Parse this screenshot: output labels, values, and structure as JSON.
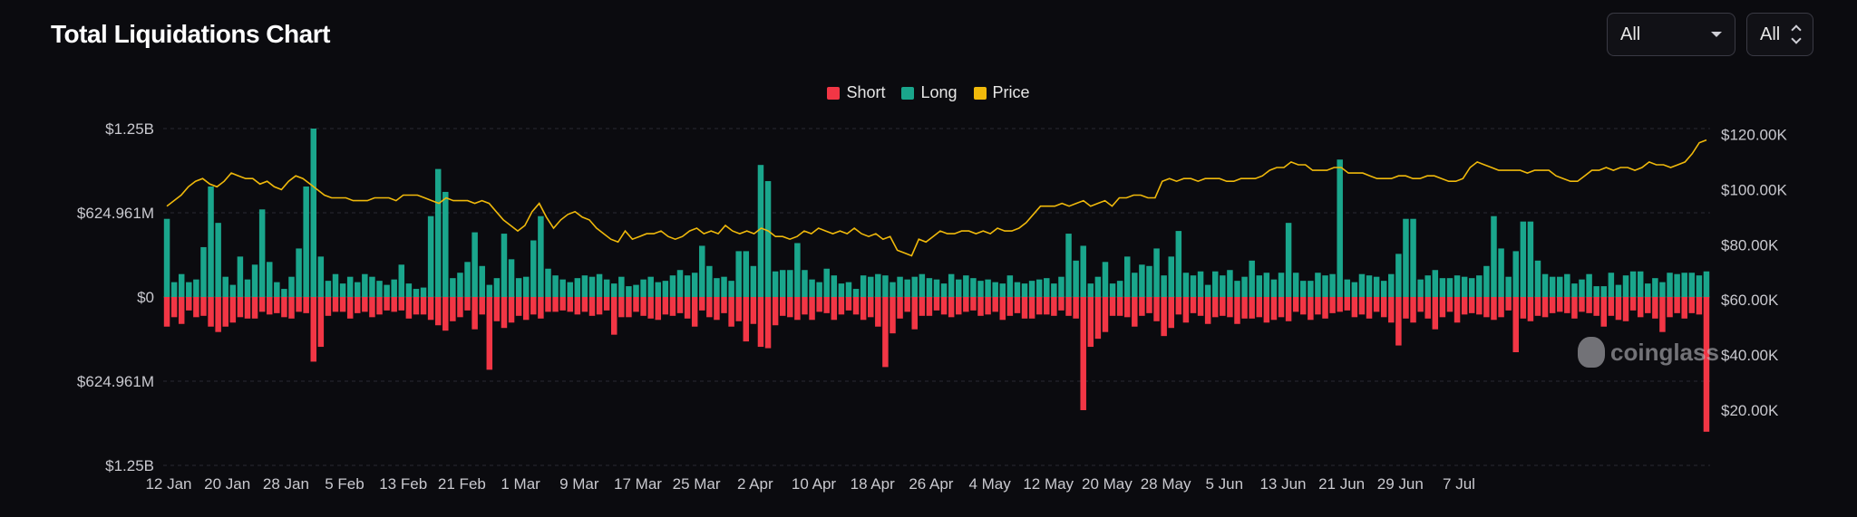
{
  "header": {
    "title": "Total Liquidations Chart"
  },
  "controls": {
    "exchange_select": "All",
    "coin_select": "All"
  },
  "watermark": "coinglass",
  "colors": {
    "short": "#f23645",
    "long": "#1aa68c",
    "price": "#f0b90b",
    "background": "#0b0b0f",
    "grid": "#2a2a33",
    "text": "#c9c9cf"
  },
  "chart_data": {
    "type": "bar",
    "title": "Total Liquidations Chart",
    "legend": [
      {
        "name": "Short",
        "color": "#f23645"
      },
      {
        "name": "Long",
        "color": "#1aa68c"
      },
      {
        "name": "Price",
        "color": "#f0b90b"
      }
    ],
    "legend_position": "top-center",
    "left_axis": {
      "ticks": [
        "$1.25B",
        "$624.961M",
        "$0",
        "$624.961M",
        "$1.25B"
      ],
      "range_millions": [
        -1250,
        1250
      ]
    },
    "right_axis": {
      "ticks": [
        "$120.00K",
        "$100.00K",
        "$80.00K",
        "$60.00K",
        "$40.00K",
        "$20.00K"
      ],
      "range": [
        0,
        130000
      ]
    },
    "x_ticks": [
      "12 Jan",
      "20 Jan",
      "28 Jan",
      "5 Feb",
      "13 Feb",
      "21 Feb",
      "1 Mar",
      "9 Mar",
      "17 Mar",
      "25 Mar",
      "2 Apr",
      "10 Apr",
      "18 Apr",
      "26 Apr",
      "4 May",
      "12 May",
      "20 May",
      "28 May",
      "5 Jun",
      "13 Jun",
      "21 Jun",
      "29 Jun",
      "7 Jul"
    ],
    "start_date": "12 Jan",
    "long_millions": [
      580,
      110,
      170,
      110,
      130,
      370,
      820,
      550,
      150,
      90,
      300,
      130,
      240,
      650,
      260,
      110,
      60,
      150,
      360,
      820,
      1250,
      300,
      120,
      170,
      100,
      150,
      110,
      170,
      150,
      120,
      90,
      130,
      240,
      100,
      60,
      70,
      600,
      950,
      780,
      140,
      180,
      260,
      480,
      230,
      90,
      140,
      470,
      280,
      140,
      150,
      420,
      600,
      210,
      160,
      130,
      110,
      140,
      160,
      150,
      170,
      130,
      100,
      150,
      80,
      90,
      130,
      150,
      110,
      120,
      160,
      200,
      160,
      180,
      380,
      230,
      140,
      150,
      120,
      340,
      340,
      230,
      980,
      860,
      190,
      200,
      200,
      400,
      200,
      130,
      110,
      210,
      160,
      100,
      110,
      60,
      160,
      150,
      170,
      160,
      110,
      150,
      130,
      150,
      170,
      140,
      130,
      100,
      170,
      130,
      160,
      140,
      120,
      130,
      110,
      100,
      160,
      110,
      100,
      120,
      130,
      140,
      100,
      150,
      470,
      270,
      380,
      100,
      150,
      260,
      100,
      120,
      300,
      180,
      240,
      230,
      360,
      160,
      300,
      490,
      180,
      160,
      190,
      90,
      190,
      160,
      200,
      120,
      150,
      270,
      160,
      180,
      130,
      180,
      550,
      180,
      120,
      120,
      180,
      160,
      170,
      1020,
      130,
      110,
      170,
      160,
      150,
      120,
      170,
      320,
      580,
      580,
      130,
      160,
      200,
      140,
      140,
      160,
      150,
      140,
      160,
      230,
      600,
      360,
      150,
      340,
      560,
      560,
      270,
      170,
      150,
      150,
      170,
      100,
      130,
      170,
      80,
      80,
      180,
      90,
      160,
      190,
      190,
      100,
      140,
      110,
      180,
      170,
      180,
      180,
      160,
      190
    ],
    "short_millions": [
      220,
      150,
      200,
      100,
      150,
      140,
      220,
      260,
      220,
      190,
      150,
      160,
      160,
      110,
      130,
      120,
      150,
      160,
      110,
      120,
      480,
      370,
      140,
      110,
      110,
      160,
      120,
      110,
      150,
      130,
      100,
      110,
      100,
      160,
      130,
      130,
      170,
      210,
      250,
      180,
      150,
      100,
      240,
      130,
      540,
      180,
      230,
      190,
      140,
      170,
      130,
      160,
      110,
      110,
      100,
      110,
      130,
      110,
      140,
      130,
      100,
      280,
      150,
      150,
      110,
      140,
      160,
      170,
      130,
      140,
      120,
      160,
      220,
      100,
      150,
      170,
      120,
      220,
      180,
      330,
      200,
      370,
      380,
      210,
      140,
      150,
      170,
      130,
      170,
      110,
      120,
      170,
      130,
      100,
      130,
      170,
      150,
      220,
      520,
      270,
      160,
      110,
      240,
      140,
      140,
      100,
      130,
      150,
      130,
      110,
      100,
      140,
      130,
      110,
      170,
      140,
      120,
      160,
      160,
      130,
      130,
      140,
      100,
      140,
      160,
      840,
      370,
      310,
      260,
      140,
      140,
      150,
      220,
      140,
      120,
      180,
      290,
      230,
      130,
      190,
      120,
      140,
      200,
      150,
      140,
      150,
      200,
      160,
      160,
      150,
      190,
      170,
      150,
      180,
      110,
      130,
      170,
      130,
      160,
      120,
      110,
      100,
      150,
      130,
      160,
      110,
      150,
      190,
      360,
      160,
      190,
      110,
      160,
      240,
      150,
      110,
      190,
      130,
      120,
      130,
      150,
      170,
      150,
      100,
      410,
      160,
      180,
      140,
      150,
      120,
      110,
      120,
      160,
      110,
      120,
      140,
      220,
      140,
      170,
      180,
      100,
      150,
      120,
      160,
      260,
      150,
      120,
      160,
      120,
      130,
      1000,
      260
    ],
    "price_thousands": [
      94,
      96,
      98,
      101,
      103,
      104,
      102,
      101,
      103,
      106,
      105,
      104,
      104,
      102,
      103,
      101,
      100,
      103,
      105,
      104,
      102,
      100,
      98,
      97,
      97,
      97,
      96,
      96,
      96,
      97,
      97,
      97,
      96,
      98,
      98,
      98,
      97,
      96,
      95,
      97,
      96,
      96,
      96,
      95,
      96,
      95,
      92,
      89,
      87,
      85,
      87,
      92,
      95,
      90,
      86,
      89,
      91,
      92,
      90,
      89,
      86,
      84,
      82,
      81,
      85,
      82,
      83,
      84,
      84,
      85,
      83,
      82,
      83,
      85,
      86,
      84,
      85,
      84,
      87,
      85,
      84,
      85,
      84,
      86,
      85,
      83,
      83,
      82,
      83,
      85,
      84,
      86,
      85,
      84,
      85,
      84,
      86,
      84,
      83,
      84,
      82,
      83,
      78,
      77,
      76,
      82,
      81,
      83,
      85,
      84,
      84,
      85,
      85,
      84,
      85,
      84,
      86,
      85,
      85,
      86,
      88,
      91,
      94,
      94,
      94,
      95,
      94,
      95,
      96,
      94,
      95,
      96,
      94,
      97,
      97,
      98,
      98,
      97,
      97,
      103,
      104,
      103,
      104,
      104,
      103,
      104,
      104,
      104,
      103,
      103,
      104,
      104,
      104,
      105,
      107,
      108,
      108,
      110,
      109,
      109,
      107,
      107,
      107,
      108,
      108,
      106,
      106,
      106,
      105,
      104,
      104,
      104,
      105,
      105,
      104,
      104,
      105,
      105,
      104,
      103,
      103,
      104,
      108,
      110,
      109,
      108,
      107,
      107,
      107,
      107,
      106,
      107,
      107,
      107,
      105,
      104,
      103,
      103,
      105,
      107,
      107,
      108,
      107,
      108,
      108,
      107,
      108,
      110,
      109,
      109,
      108,
      109,
      110,
      113,
      117,
      118
    ]
  }
}
